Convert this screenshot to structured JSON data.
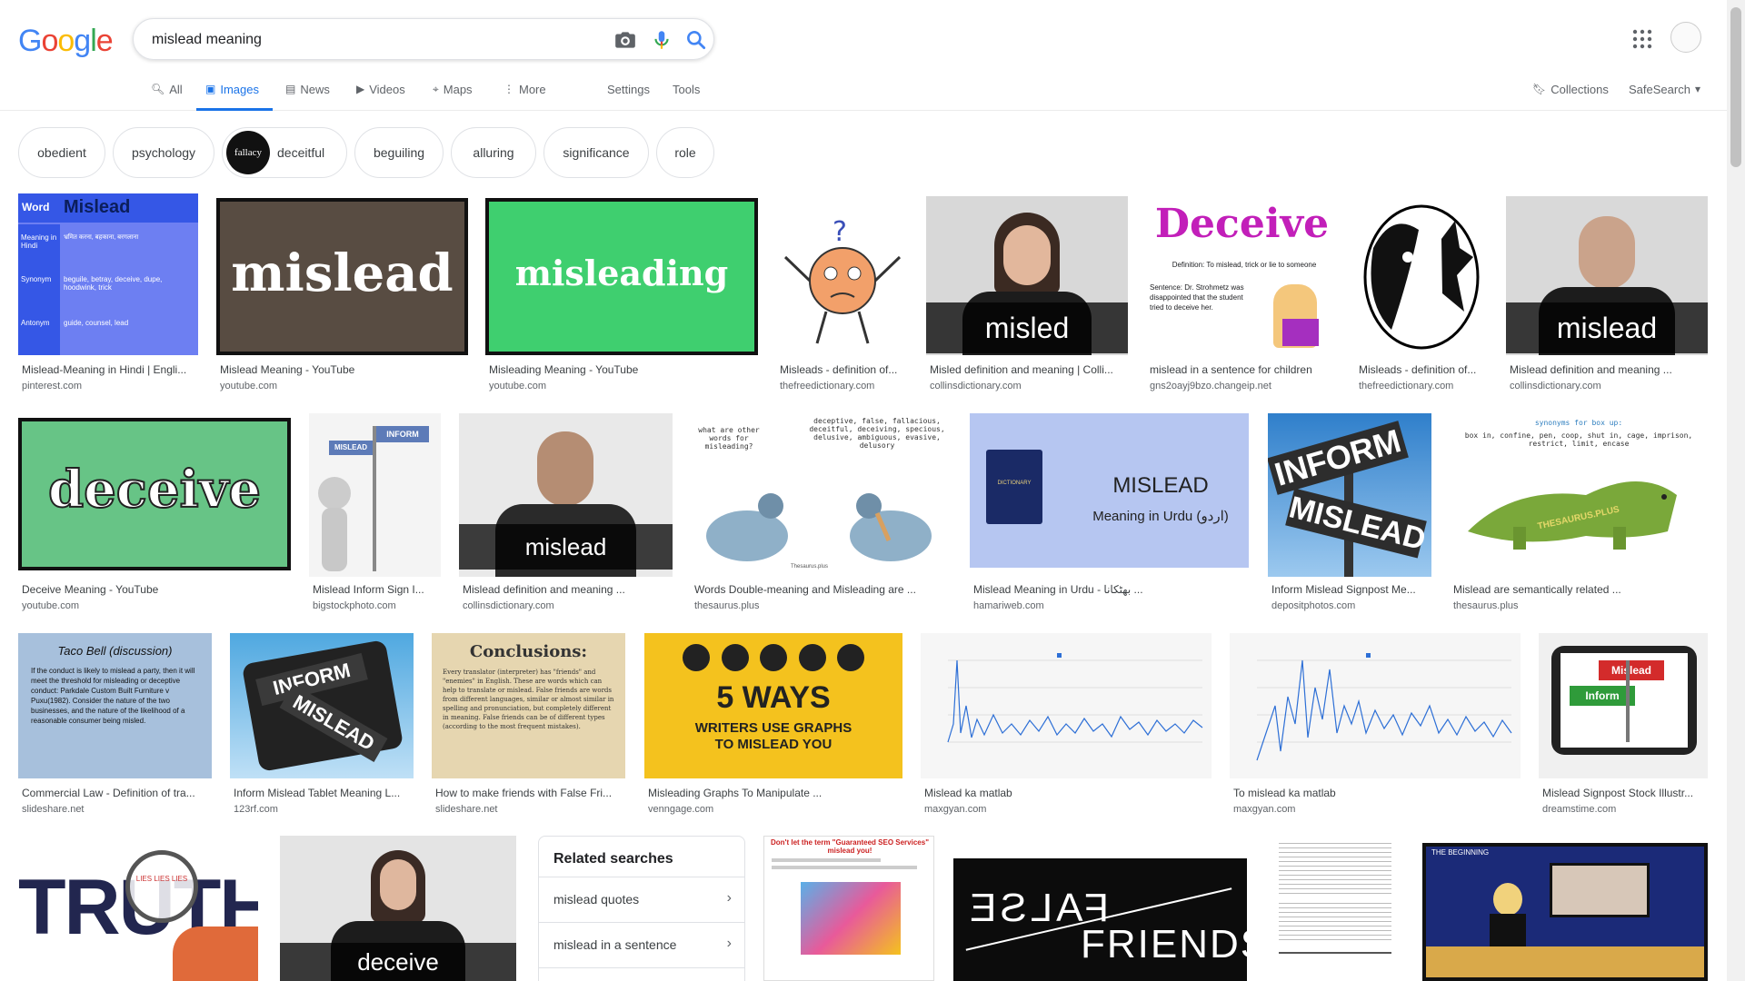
{
  "header": {
    "logo": "Google",
    "search_value": "mislead meaning",
    "apps_icon": "apps-grid-icon",
    "avatar_icon": "avatar"
  },
  "tabs": [
    {
      "label": "All",
      "icon": "search-icon"
    },
    {
      "label": "Images",
      "icon": "image-icon"
    },
    {
      "label": "News",
      "icon": "news-icon"
    },
    {
      "label": "Videos",
      "icon": "video-icon"
    },
    {
      "label": "Maps",
      "icon": "map-icon"
    },
    {
      "label": "More",
      "icon": "more-icon"
    },
    {
      "label": "Settings"
    },
    {
      "label": "Tools"
    }
  ],
  "right_links": {
    "collections": "Collections",
    "safesearch": "SafeSearch"
  },
  "chips": [
    "obedient",
    "psychology",
    "deceitful",
    "beguiling",
    "alluring",
    "significance",
    "role"
  ],
  "chip_thumb_text": "fallacy",
  "results_row1": [
    {
      "title": "Mislead-Meaning in Hindi | Engli...",
      "source": "pinterest.com"
    },
    {
      "title": "Mislead Meaning - YouTube",
      "source": "youtube.com"
    },
    {
      "title": "Misleading Meaning - YouTube",
      "source": "youtube.com"
    },
    {
      "title": "Misleads - definition of...",
      "source": "thefreedictionary.com"
    },
    {
      "title": "Misled definition and meaning | Colli...",
      "source": "collinsdictionary.com"
    },
    {
      "title": "mislead in a sentence for children",
      "source": "gns2oayj9bzo.changeip.net"
    },
    {
      "title": "Misleads - definition of...",
      "source": "thefreedictionary.com"
    },
    {
      "title": "Mislead definition and meaning ...",
      "source": "collinsdictionary.com"
    }
  ],
  "results_row2": [
    {
      "title": "Deceive Meaning - YouTube",
      "source": "youtube.com"
    },
    {
      "title": "Mislead Inform Sign I...",
      "source": "bigstockphoto.com"
    },
    {
      "title": "Mislead definition and meaning ...",
      "source": "collinsdictionary.com"
    },
    {
      "title": "Words Double-meaning and Misleading are ...",
      "source": "thesaurus.plus"
    },
    {
      "title": "Mislead Meaning in Urdu - بھٹکانا ...",
      "source": "hamariweb.com"
    },
    {
      "title": "Inform Mislead Signpost Me...",
      "source": "depositphotos.com"
    },
    {
      "title": "Mislead are semantically related ...",
      "source": "thesaurus.plus"
    }
  ],
  "results_row3": [
    {
      "title": "Commercial Law - Definition of tra...",
      "source": "slideshare.net"
    },
    {
      "title": "Inform Mislead Tablet Meaning L...",
      "source": "123rf.com"
    },
    {
      "title": "How to make friends with False Fri...",
      "source": "slideshare.net"
    },
    {
      "title": "Misleading Graphs To Manipulate ...",
      "source": "venngage.com"
    },
    {
      "title": "Mislead ka matlab",
      "source": "maxgyan.com"
    },
    {
      "title": "To mislead ka matlab",
      "source": "maxgyan.com"
    },
    {
      "title": "Mislead Signpost Stock Illustr...",
      "source": "dreamstime.com"
    }
  ],
  "thumbs": {
    "r1_hindi": {
      "word": "Word",
      "head": "Mislead",
      "rows": [
        {
          "k": "Meaning in Hindi",
          "v": "भ्रमित करना, बहकाना, बरगलाना"
        },
        {
          "k": "Synonym",
          "v": "beguile, betray, deceive, dupe, hoodwink, trick"
        },
        {
          "k": "Antonym",
          "v": "guide, counsel, lead"
        }
      ]
    },
    "r1_mislead": "mislead",
    "r1_misleading": "misleading",
    "r1_misled": "misled",
    "r1_deceive_title": "Deceive",
    "r1_deceive_def": "Definition: To mislead, trick or lie to someone",
    "r1_deceive_sentence": "Sentence: Dr. Strohmetz was disappointed that the student tried to deceive her.",
    "r1_mislead_band": "mislead",
    "r2_deceive": "deceive",
    "r2_sign_top": "INFORM",
    "r2_sign_bottom": "MISLEAD",
    "r2_mislead_band": "mislead",
    "r2_birds_q": "what are other words for misleading?",
    "r2_birds_list": "deceptive, false, fallacious, deceitful, deceiving, specious, delusive, ambiguous, evasive, delusory",
    "r2_birds_brand": "Thesaurus.plus",
    "r2_urdu_title": "MISLEAD",
    "r2_urdu_sub": "Meaning in Urdu (اردو)",
    "r2_book": "DICTIONARY",
    "r2_signpost_top": "INFORM",
    "r2_signpost_bottom": "MISLEAD",
    "r2_dino_head": "synonyms for box up:",
    "r2_dino_list": "box in, confine, pen, coop, shut in, cage, imprison, restrict, limit, encase",
    "r2_dino_brand": "THESAURUS.PLUS",
    "r3_taco_title": "Taco Bell (discussion)",
    "r3_taco_body": "If the conduct is likely to mislead a party, then it will meet the threshold for misleading or deceptive conduct: Parkdale Custom Built Furniture v Puxu(1982). Consider the nature of the two businesses, and the nature of the likelihood of a reasonable consumer being misled.",
    "r3_tablet_top": "INFORM",
    "r3_tablet_bottom": "MISLEAD",
    "r3_conc_title": "Conclusions:",
    "r3_conc_body": "Every translator (interpreter) has \"friends\" and \"enemies\" in English. These are words which can help to translate or mislead. False friends are words from different languages, similar or almost similar in spelling and pronunciation, but completely different in meaning. False friends can be of different types (according to the most frequent mistakes).",
    "r3_ways_big": "5 WAYS",
    "r3_ways_sub": "WRITERS USE GRAPHS TO MISLEAD YOU",
    "r3_sign_red": "Mislead",
    "r3_sign_green": "Inform",
    "r4_truth": "TRUTH",
    "r4_truth_lens": "LIES LIES LIES",
    "r4_deceive": "deceive",
    "r4_seo_title": "Don't let the term \"Guaranteed SEO Services\" mislead you!",
    "r4_false": "FALSE",
    "r4_friends": "FRIENDS",
    "r4_beginning": "THE BEGINNING"
  },
  "related": {
    "heading": "Related searches",
    "items": [
      "mislead quotes",
      "mislead in a sentence"
    ]
  },
  "colors": {
    "accent": "#1a73e8",
    "chip_border": "#dfe1e5"
  }
}
